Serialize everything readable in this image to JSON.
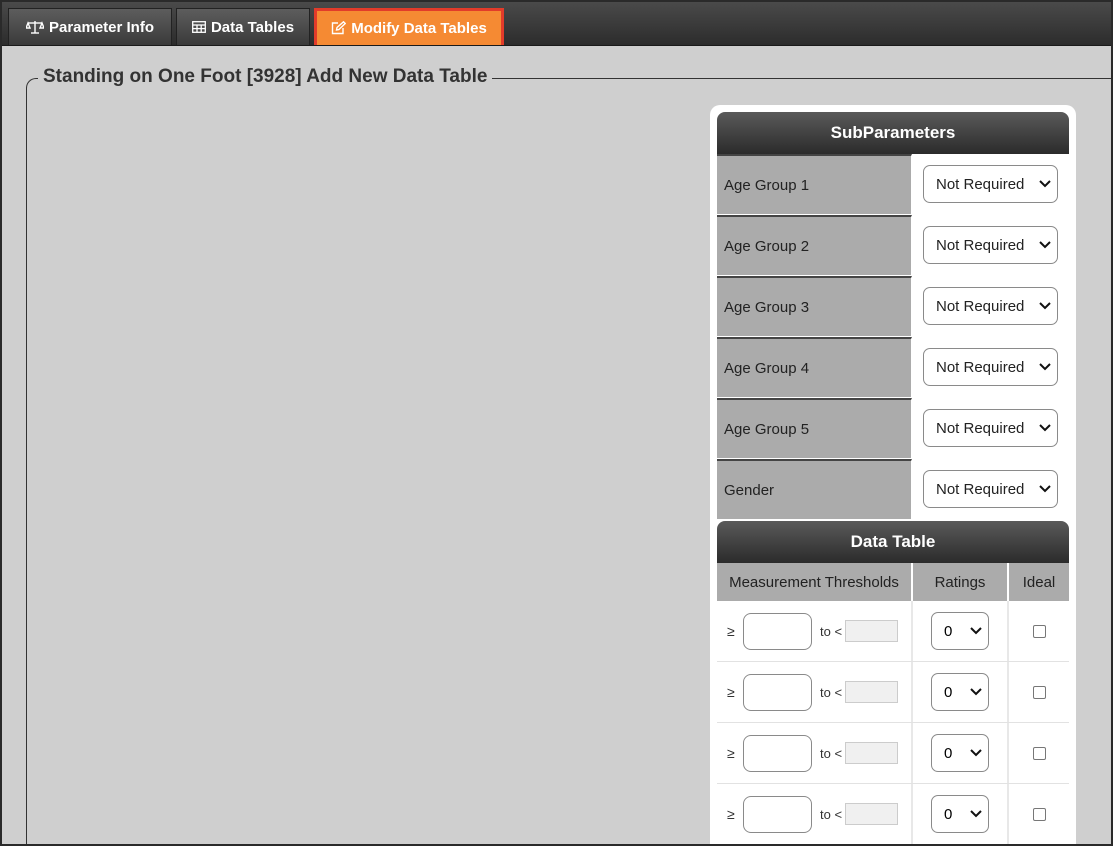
{
  "tabs": [
    {
      "label": "Parameter Info",
      "icon": "balance-scale-icon"
    },
    {
      "label": "Data Tables",
      "icon": "table-icon"
    },
    {
      "label": "Modify Data Tables",
      "icon": "edit-icon",
      "active": true
    }
  ],
  "page": {
    "title": "Standing on One Foot [3928] Add New Data Table"
  },
  "subparameters": {
    "header": "SubParameters",
    "rows": [
      {
        "label": "Age Group 1",
        "value": "Not Required"
      },
      {
        "label": "Age Group 2",
        "value": "Not Required"
      },
      {
        "label": "Age Group 3",
        "value": "Not Required"
      },
      {
        "label": "Age Group 4",
        "value": "Not Required"
      },
      {
        "label": "Age Group 5",
        "value": "Not Required"
      },
      {
        "label": "Gender",
        "value": "Not Required"
      }
    ]
  },
  "data_table": {
    "header": "Data Table",
    "columns": [
      "Measurement Thresholds",
      "Ratings",
      "Ideal"
    ],
    "ge_symbol": "≥",
    "to_label": "to <",
    "rows": [
      {
        "rating": "0",
        "ideal": false
      },
      {
        "rating": "0",
        "ideal": false
      },
      {
        "rating": "0",
        "ideal": false
      },
      {
        "rating": "0",
        "ideal": false
      }
    ]
  },
  "colors": {
    "active_tab": "#f58a33",
    "active_tab_border": "#e23b2a",
    "background": "#cfcfcf"
  }
}
